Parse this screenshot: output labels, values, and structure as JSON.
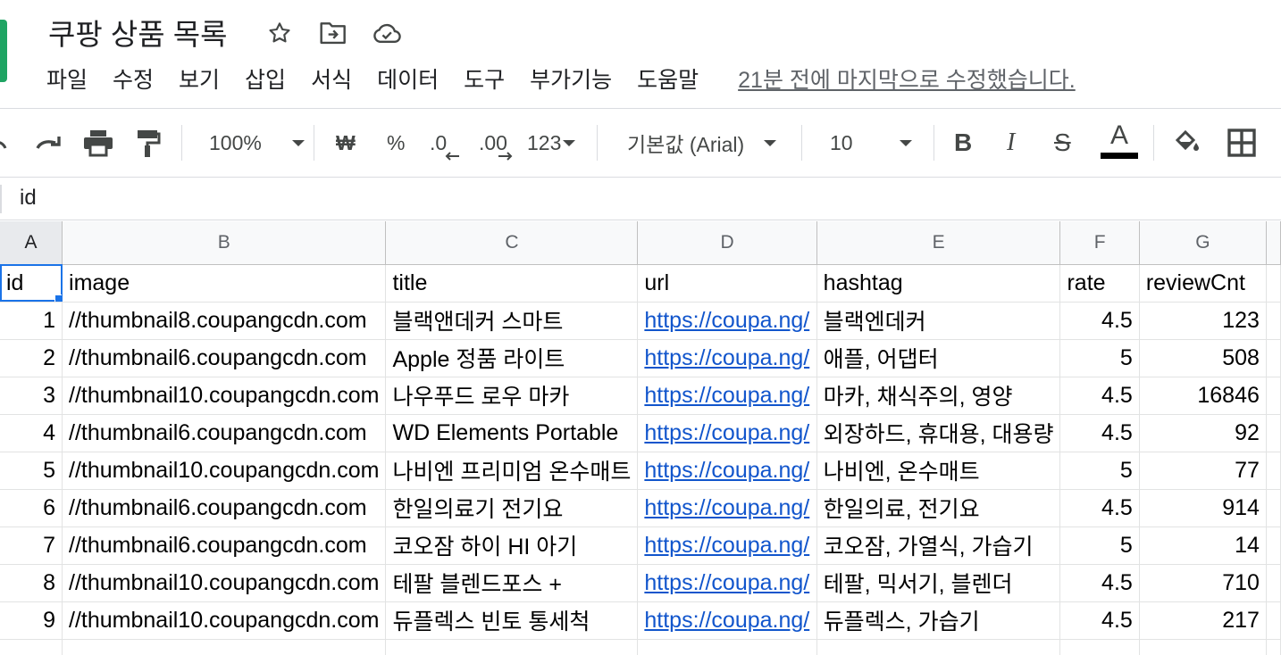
{
  "document": {
    "title": "쿠팡 상품 목록"
  },
  "title_icons": [
    "star-icon",
    "move-to-folder-icon",
    "cloud-saved-icon"
  ],
  "menu": {
    "items": [
      "파일",
      "수정",
      "보기",
      "삽입",
      "서식",
      "데이터",
      "도구",
      "부가기능",
      "도움말"
    ],
    "last_edit": "21분 전에 마지막으로 수정했습니다."
  },
  "toolbar": {
    "zoom": "100%",
    "currency": "₩",
    "percent": "%",
    "decimal_decrease": ".0",
    "decimal_increase": ".00",
    "more_formats": "123",
    "font": "기본값 (Arial)",
    "font_size": "10",
    "bold": "B",
    "italic": "I",
    "strikethrough": "S",
    "text_color": "A",
    "text_color_value": "#000000"
  },
  "formula_bar": {
    "value": "id"
  },
  "grid": {
    "columns": [
      "A",
      "B",
      "C",
      "D",
      "E",
      "F",
      "G"
    ],
    "rows": [
      [
        "id",
        "image",
        "title",
        "url",
        "hashtag",
        "rate",
        "reviewCnt"
      ],
      [
        "1",
        "//thumbnail8.coupangcdn.com",
        "블랙앤데커 스마트",
        "https://coupa.ng/",
        "블랙엔데커",
        "4.5",
        "123"
      ],
      [
        "2",
        "//thumbnail6.coupangcdn.com",
        "Apple 정품 라이트",
        "https://coupa.ng/",
        "애플, 어댑터",
        "5",
        "508"
      ],
      [
        "3",
        "//thumbnail10.coupangcdn.com",
        "나우푸드 로우 마카",
        "https://coupa.ng/",
        "마카, 채식주의, 영양",
        "4.5",
        "16846"
      ],
      [
        "4",
        "//thumbnail6.coupangcdn.com",
        "WD Elements Portable",
        "https://coupa.ng/",
        "외장하드, 휴대용, 대용량",
        "4.5",
        "92"
      ],
      [
        "5",
        "//thumbnail10.coupangcdn.com",
        "나비엔 프리미엄 온수매트",
        "https://coupa.ng/",
        "나비엔, 온수매트",
        "5",
        "77"
      ],
      [
        "6",
        "//thumbnail6.coupangcdn.com",
        "한일의료기 전기요",
        "https://coupa.ng/",
        "한일의료, 전기요",
        "4.5",
        "914"
      ],
      [
        "7",
        "//thumbnail6.coupangcdn.com",
        "코오잠 하이 HI 아기",
        "https://coupa.ng/",
        "코오잠, 가열식, 가습기",
        "5",
        "14"
      ],
      [
        "8",
        "//thumbnail10.coupangcdn.com",
        "테팔 블렌드포스 +",
        "https://coupa.ng/",
        "테팔, 믹서기, 블렌더",
        "4.5",
        "710"
      ],
      [
        "9",
        "//thumbnail10.coupangcdn.com",
        "듀플렉스 빈토 통세척",
        "https://coupa.ng/",
        "듀플렉스, 가습기",
        "4.5",
        "217"
      ],
      [
        "",
        "",
        "",
        "",
        "",
        "",
        ""
      ]
    ]
  },
  "colors": {
    "accent": "#1a73e8",
    "link": "#1155cc",
    "sheets_green": "#1fa463"
  }
}
